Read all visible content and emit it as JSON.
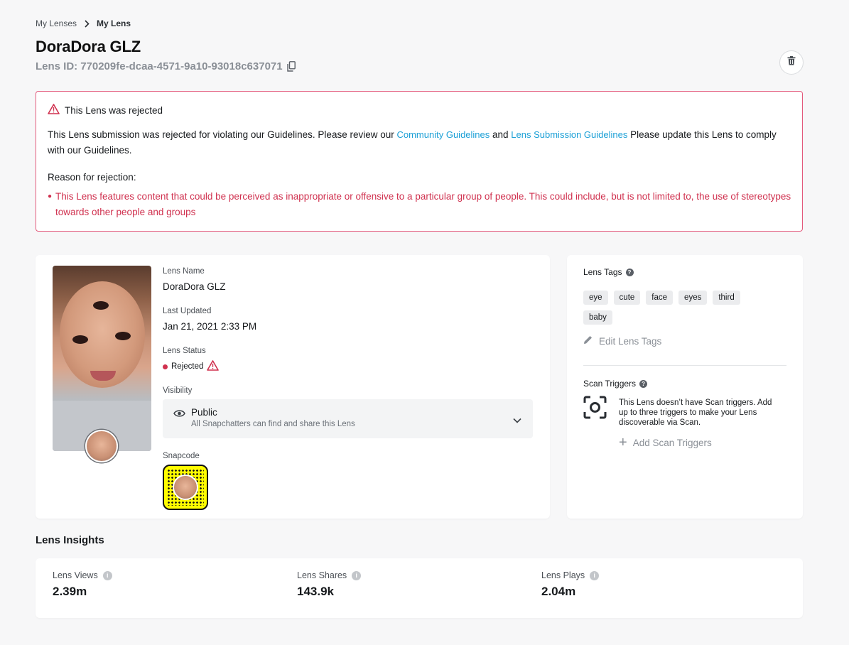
{
  "breadcrumb": {
    "parent": "My Lenses",
    "current": "My Lens"
  },
  "lens": {
    "title": "DoraDora GLZ",
    "id_label": "Lens ID:",
    "id_value": "770209fe-dcaa-4571-9a10-93018c637071"
  },
  "alert": {
    "title": "This Lens was rejected",
    "body_prefix": "This Lens submission was rejected for violating our Guidelines. Please review our ",
    "link_community": "Community Guidelines",
    "body_and": " and ",
    "link_submission": "Lens Submission Guidelines",
    "body_suffix": " Please update this Lens to comply with our Guidelines.",
    "reason_title": "Reason for rejection:",
    "reasons": [
      "This Lens features content that could be perceived as inappropriate or offensive to a particular group of people. This could include, but is not limited to, the use of stereotypes towards other people and groups"
    ]
  },
  "details": {
    "name_label": "Lens Name",
    "name_value": "DoraDora GLZ",
    "updated_label": "Last Updated",
    "updated_value": "Jan 21, 2021 2:33 PM",
    "status_label": "Lens Status",
    "status_value": "Rejected",
    "visibility_label": "Visibility",
    "visibility_value": "Public",
    "visibility_desc": "All Snapchatters can find and share this Lens",
    "snapcode_label": "Snapcode"
  },
  "tags_panel": {
    "heading": "Lens Tags",
    "tags": [
      "eye",
      "cute",
      "face",
      "eyes",
      "third",
      "baby"
    ],
    "edit_label": "Edit Lens Tags",
    "scan_heading": "Scan Triggers",
    "scan_text": "This Lens doesn’t have Scan triggers. Add up to three triggers to make your Lens discoverable via Scan.",
    "add_scan_label": "Add Scan Triggers"
  },
  "insights": {
    "heading": "Lens Insights",
    "metrics": [
      {
        "label": "Lens Views",
        "value": "2.39m"
      },
      {
        "label": "Lens Shares",
        "value": "143.9k"
      },
      {
        "label": "Lens Plays",
        "value": "2.04m"
      }
    ]
  },
  "colors": {
    "accent_link": "#1a9fd6",
    "error": "#d0314f",
    "snapcode_yellow": "#fffc00"
  }
}
